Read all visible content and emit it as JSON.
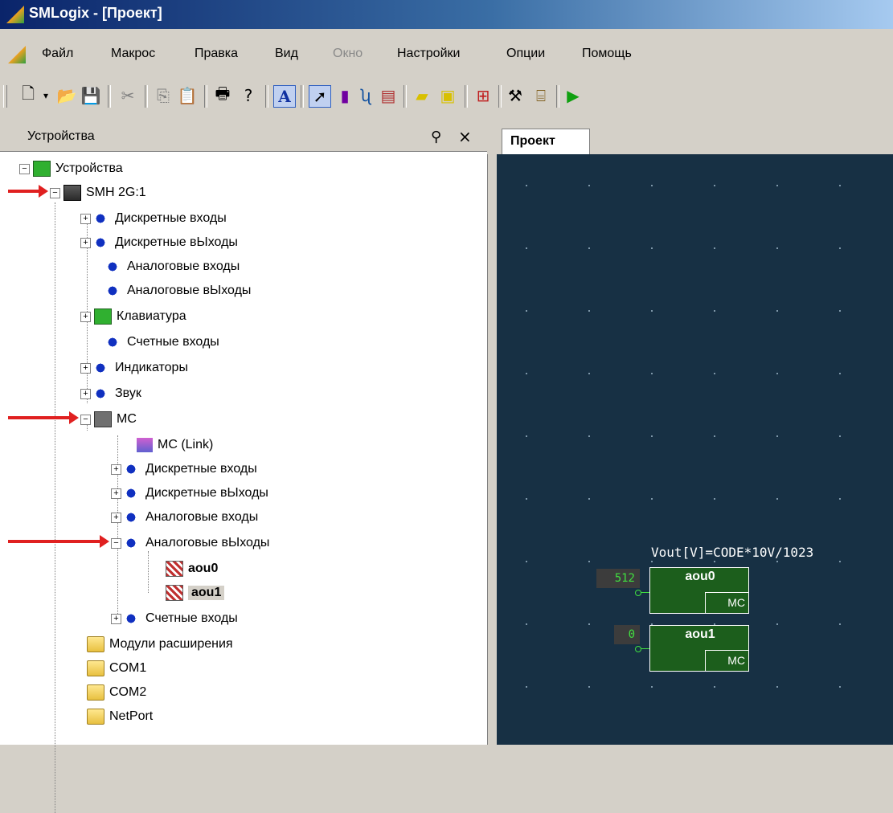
{
  "window": {
    "title": "SMLogix - [Проект]"
  },
  "menu": [
    {
      "label": "Файл",
      "disabled": false
    },
    {
      "label": "Макрос",
      "disabled": false
    },
    {
      "label": "Правка",
      "disabled": false
    },
    {
      "label": "Вид",
      "disabled": false
    },
    {
      "label": "Окно",
      "disabled": true
    },
    {
      "label": "Настройки",
      "disabled": false
    },
    {
      "label": "Опции",
      "disabled": false
    },
    {
      "label": "Помощь",
      "disabled": false
    }
  ],
  "toolbar": {
    "buttons": [
      "new-file-icon",
      "dropdown-arrow-icon",
      "open-folder-icon",
      "save-icon",
      "cut-icon",
      "copy-icon",
      "paste-icon",
      "print-icon",
      "help-icon",
      "text-tool-icon",
      "pointer-tool-icon",
      "block-tool-icon",
      "wire-tool-icon",
      "component-tool-icon",
      "macro-icon",
      "macro-edit-icon",
      "export-icon",
      "build-hammer-icon",
      "device-icon",
      "run-icon"
    ],
    "text_tool_glyph": "A"
  },
  "devices_panel": {
    "title": "Устройства",
    "tree": [
      {
        "label": "Устройства",
        "icon": "devices-root-icon"
      },
      {
        "label": "SMH 2G:1",
        "icon": "smh-device-icon"
      },
      {
        "label": "Дискретные входы",
        "icon": "discrete-input-icon"
      },
      {
        "label": "Дискретные вЫходы",
        "icon": "discrete-output-icon"
      },
      {
        "label": "Аналоговые входы",
        "icon": "analog-input-icon"
      },
      {
        "label": "Аналоговые вЫходы",
        "icon": "analog-output-icon"
      },
      {
        "label": "Клавиатура",
        "icon": "keyboard-icon"
      },
      {
        "label": "Счетные входы",
        "icon": "counter-input-icon"
      },
      {
        "label": "Индикаторы",
        "icon": "indicator-icon"
      },
      {
        "label": "Звук",
        "icon": "sound-icon"
      },
      {
        "label": "MC",
        "icon": "mc-module-icon"
      },
      {
        "label": "MC (Link)",
        "icon": "link-icon"
      },
      {
        "label": "Дискретные входы",
        "icon": "discrete-input-icon"
      },
      {
        "label": "Дискретные вЫходы",
        "icon": "discrete-output-icon"
      },
      {
        "label": "Аналоговые входы",
        "icon": "analog-input-icon"
      },
      {
        "label": "Аналоговые вЫходы",
        "icon": "analog-output-icon"
      },
      {
        "label": "aou0",
        "icon": "analog-channel-icon"
      },
      {
        "label": "aou1",
        "icon": "analog-channel-icon"
      },
      {
        "label": "Счетные входы",
        "icon": "counter-input-icon"
      },
      {
        "label": "Модули расширения",
        "icon": "folder-icon"
      },
      {
        "label": "COM1",
        "icon": "folder-icon"
      },
      {
        "label": "COM2",
        "icon": "folder-icon"
      },
      {
        "label": "NetPort",
        "icon": "folder-icon"
      }
    ]
  },
  "editor": {
    "tab": "Проект",
    "formula": "Vout[V]=CODE*10V/1023",
    "blocks": [
      {
        "name": "aou0",
        "module": "MC",
        "value": "512"
      },
      {
        "name": "aou1",
        "module": "MC",
        "value": "0"
      }
    ]
  }
}
